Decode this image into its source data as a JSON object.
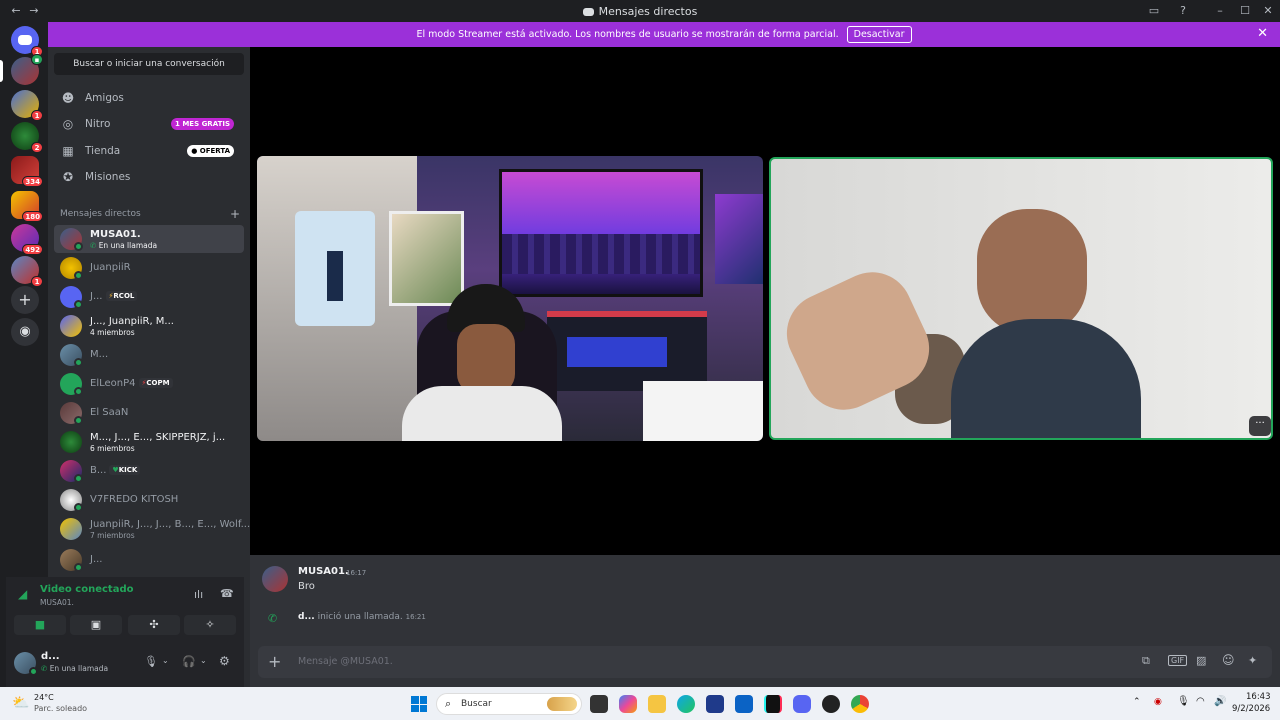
{
  "window": {
    "title": "Mensajes directos"
  },
  "banner": {
    "text": "El modo Streamer está activado. Los nombres de usuario se mostrarán de forma parcial.",
    "button": "Desactivar"
  },
  "rail": {
    "badges": [
      "1",
      "1",
      "2",
      "334",
      "180",
      "492",
      "1"
    ]
  },
  "sidebar": {
    "search": "Buscar o iniciar una conversación",
    "nav": [
      {
        "label": "Amigos"
      },
      {
        "label": "Nitro",
        "badge": "1 MES GRATIS"
      },
      {
        "label": "Tienda",
        "badge": "OFERTA"
      },
      {
        "label": "Misiones"
      }
    ],
    "dm_header": "Mensajes directos",
    "dms": [
      {
        "name": "MUSA01.",
        "sub": "En una llamada"
      },
      {
        "name": "JuanpiiR"
      },
      {
        "name": "J...",
        "tag": "RCOL"
      },
      {
        "name": "J..., JuanpiiR, M...",
        "sub": "4 miembros"
      },
      {
        "name": "M..."
      },
      {
        "name": "ElLeonP4",
        "tag": "COPM"
      },
      {
        "name": "El SaaN"
      },
      {
        "name": "M..., J..., E..., SKIPPERJZ, j...",
        "sub": "6 miembros"
      },
      {
        "name": "B...",
        "tag": "KICK"
      },
      {
        "name": "V7FREDO KITOSH"
      },
      {
        "name": "JuanpiiR, J..., J..., B..., E..., Wolf...",
        "sub": "7 miembros"
      },
      {
        "name": "J..."
      }
    ]
  },
  "voice": {
    "status": "Video conectado",
    "channel": "MUSA01."
  },
  "user": {
    "name": "d...",
    "status": "En una llamada"
  },
  "chat": {
    "messages": [
      {
        "author": "MUSA01.",
        "time": "16:17",
        "text": "Bro"
      }
    ],
    "call": {
      "user": "d...",
      "text": "inició una llamada.",
      "time": "16:21"
    },
    "placeholder": "Mensaje @MUSA01."
  },
  "taskbar": {
    "weather_temp": "24°C",
    "weather_desc": "Parc. soleado",
    "search": "Buscar",
    "time": "16:43",
    "date": "9/2/2026"
  },
  "colors": {
    "banner": "#9b30d9",
    "online": "#23a55a",
    "badge": "#f23f43",
    "nitro": "#c026d3"
  }
}
